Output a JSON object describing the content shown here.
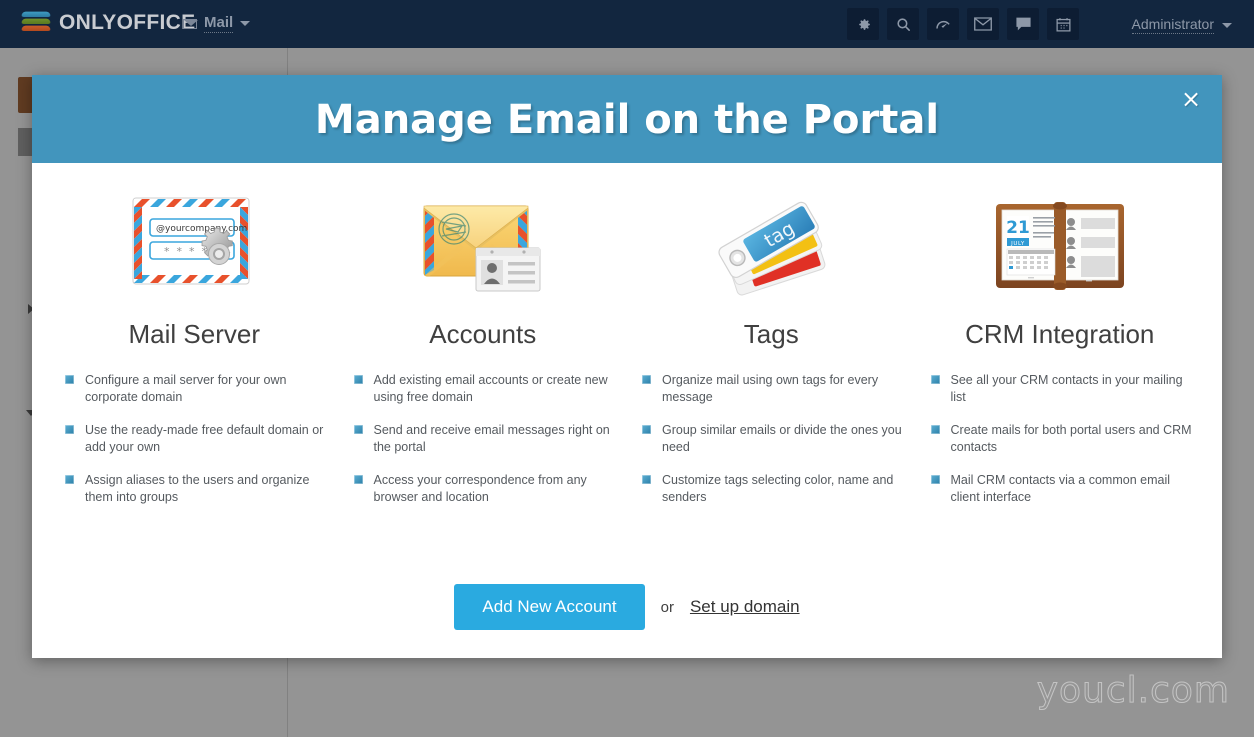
{
  "topbar": {
    "logo_text": "ONLYOFFICE",
    "module_name": "Mail",
    "module_icon": "envelope-icon",
    "caret_icon": "chevron-down-icon",
    "nav_icons": [
      {
        "name": "gear-icon",
        "label": "Settings"
      },
      {
        "name": "search-icon",
        "label": "Search"
      },
      {
        "name": "gauge-icon",
        "label": "Performance"
      },
      {
        "name": "envelope-icon",
        "label": "Mail"
      },
      {
        "name": "chat-icon",
        "label": "Talk"
      },
      {
        "name": "calendar-icon",
        "label": "Calendar"
      }
    ],
    "user_name": "Administrator"
  },
  "modal": {
    "title": "Manage Email on the Portal",
    "close_label": "×",
    "columns": [
      {
        "icon": "mail-server-icon",
        "heading": "Mail Server",
        "bullets": [
          "Configure a mail server for your own corporate domain",
          "Use the ready-made free default domain or add your own",
          "Assign aliases to the users and organize them into groups"
        ]
      },
      {
        "icon": "accounts-icon",
        "heading": "Accounts",
        "bullets": [
          "Add existing email accounts or create new using free domain",
          "Send and receive email messages right on the portal",
          "Access your correspondence from any browser and location"
        ]
      },
      {
        "icon": "tags-icon",
        "heading": "Tags",
        "bullets": [
          "Organize mail using own tags for every message",
          "Group similar emails or divide the ones you need",
          "Customize tags selecting color, name and senders"
        ]
      },
      {
        "icon": "crm-integration-icon",
        "heading": "CRM Integration",
        "bullets": [
          "See all your CRM contacts in your mailing list",
          "Create mails for both portal users and CRM contacts",
          "Mail CRM contacts via a common email client interface"
        ]
      }
    ],
    "footer": {
      "primary_button": "Add New Account",
      "or_text": "or",
      "link_text": "Set up domain"
    },
    "illustration_text": {
      "mail_server_email": "@yourcompany.com",
      "mail_server_password": "* * * *",
      "tag_label": "tag",
      "calendar_day": "21",
      "calendar_month": "JULY"
    }
  },
  "watermark": "youcl.com",
  "colors": {
    "topbar": "#12263f",
    "modal_header": "#4295bd",
    "primary_button": "#2aaae0",
    "bullet": "#3b8fb5",
    "background_button": "#8c3a00"
  }
}
